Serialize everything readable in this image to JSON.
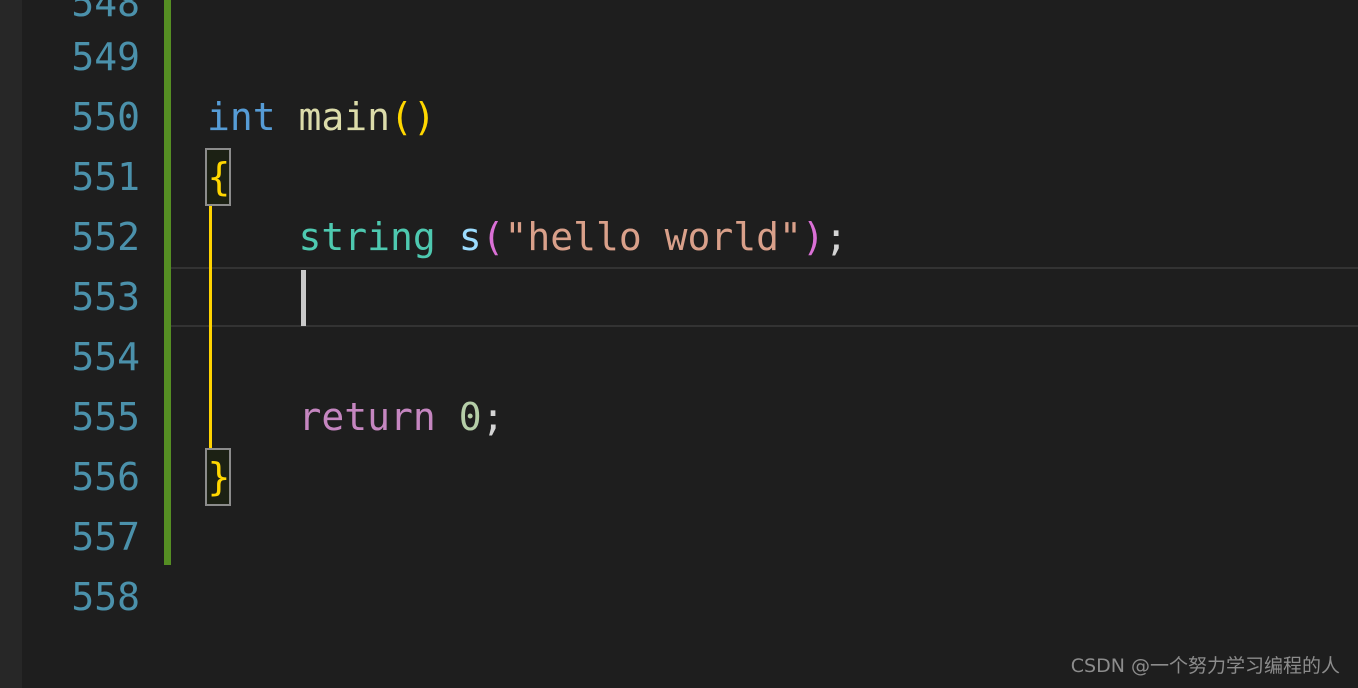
{
  "editor": {
    "background": "#1e1e1e",
    "gutter_background": "#1e1e1e",
    "left_strip_color": "#272727",
    "line_number_color": "#4b91ab",
    "git_modified_bar_color": "#558e23",
    "indent_guide_color": "#ffd300",
    "caret_color": "#c9c9c9",
    "current_line_border_color": "#333333",
    "bracket_match_border_color": "#8c8c8c",
    "bracket_match_background": "#1c2114"
  },
  "gutter": {
    "line_numbers": [
      "548",
      "549",
      "550",
      "551",
      "552",
      "553",
      "554",
      "555",
      "556",
      "557",
      "558"
    ]
  },
  "code": {
    "language": "cpp",
    "cursor_line": "553",
    "cursor_column": "5",
    "lines": [
      {
        "number": "548",
        "text": ""
      },
      {
        "number": "549",
        "text": ""
      },
      {
        "number": "550",
        "text": "int main()"
      },
      {
        "number": "551",
        "text": "{"
      },
      {
        "number": "552",
        "text": "    string s(\"hello world\");"
      },
      {
        "number": "553",
        "text": "    "
      },
      {
        "number": "554",
        "text": ""
      },
      {
        "number": "555",
        "text": "    return 0;"
      },
      {
        "number": "556",
        "text": "}"
      },
      {
        "number": "557",
        "text": ""
      },
      {
        "number": "558",
        "text": ""
      }
    ],
    "tokens": {
      "line550": {
        "keyword": "int",
        "space": " ",
        "function": "main",
        "parens": "()"
      },
      "line551": {
        "brace_open": "{"
      },
      "line552": {
        "indent": "    ",
        "type": "string",
        "space": " ",
        "variable": "s",
        "paren_open": "(",
        "string_literal": "\"hello world\"",
        "paren_close": ")",
        "semicolon": ";"
      },
      "line555": {
        "indent": "    ",
        "control": "return",
        "space": " ",
        "number": "0",
        "semicolon": ";"
      },
      "line556": {
        "brace_close": "}"
      }
    },
    "token_colors": {
      "keyword": "#569cd6",
      "function": "#dcdcaa",
      "parens": "#ffd700",
      "type": "#4ec9b0",
      "variable": "#9cdcfe",
      "call_parens": "#da70d6",
      "string": "#d9a08a",
      "punctuation": "#d4d4d4",
      "control_keyword": "#c586c0",
      "number": "#b5cea8",
      "brace": "#ffd700"
    }
  },
  "watermark": {
    "text": "CSDN @一个努力学习编程的人",
    "color": "#8c8c8c"
  }
}
